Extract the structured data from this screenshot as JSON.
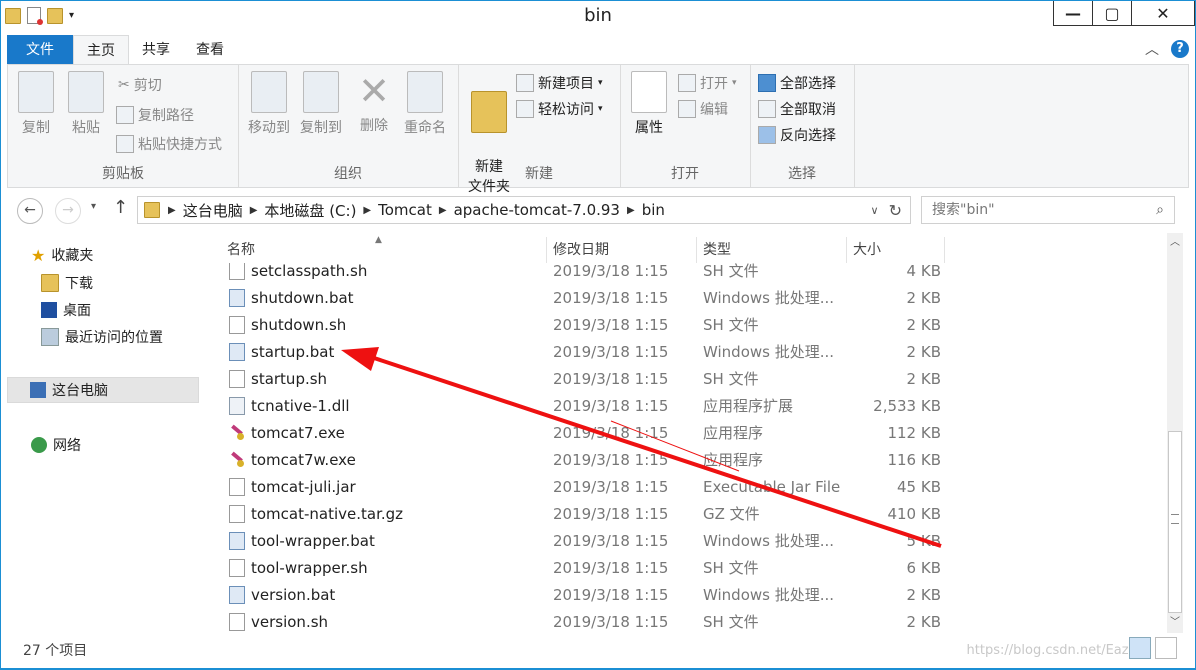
{
  "window": {
    "title": "bin"
  },
  "window_buttons": {
    "minimize": "—",
    "maximize": "▢",
    "close": "✕"
  },
  "tabs": [
    {
      "label": "文件"
    },
    {
      "label": "主页"
    },
    {
      "label": "共享"
    },
    {
      "label": "查看"
    }
  ],
  "ribbon": {
    "clipboard": {
      "label": "剪贴板",
      "copy": "复制",
      "paste": "粘贴",
      "cut": "剪切",
      "copy_path": "复制路径",
      "paste_shortcut": "粘贴快捷方式"
    },
    "organize": {
      "label": "组织",
      "move_to": "移动到",
      "copy_to": "复制到",
      "delete": "删除",
      "rename": "重命名"
    },
    "new": {
      "label": "新建",
      "new_folder": "新建\n文件夹",
      "new_item": "新建项目",
      "easy_access": "轻松访问"
    },
    "open": {
      "label": "打开",
      "properties": "属性",
      "open": "打开",
      "edit": "编辑"
    },
    "select": {
      "label": "选择",
      "select_all": "全部选择",
      "select_none": "全部取消",
      "invert": "反向选择"
    }
  },
  "address": {
    "crumbs": [
      "这台电脑",
      "本地磁盘 (C:)",
      "Tomcat",
      "apache-tomcat-7.0.93",
      "bin"
    ],
    "search_placeholder": "搜索\"bin\""
  },
  "nav": {
    "favorites": "收藏夹",
    "downloads": "下载",
    "desktop": "桌面",
    "recent": "最近访问的位置",
    "this_pc": "这台电脑",
    "network": "网络"
  },
  "columns": {
    "name": "名称",
    "date": "修改日期",
    "type": "类型",
    "size": "大小"
  },
  "files": [
    {
      "name": "setclasspath.sh",
      "date": "2019/3/18 1:15",
      "type": "SH 文件",
      "size": "4 KB",
      "icon": "file"
    },
    {
      "name": "shutdown.bat",
      "date": "2019/3/18 1:15",
      "type": "Windows 批处理...",
      "size": "2 KB",
      "icon": "bat"
    },
    {
      "name": "shutdown.sh",
      "date": "2019/3/18 1:15",
      "type": "SH 文件",
      "size": "2 KB",
      "icon": "file"
    },
    {
      "name": "startup.bat",
      "date": "2019/3/18 1:15",
      "type": "Windows 批处理...",
      "size": "2 KB",
      "icon": "bat"
    },
    {
      "name": "startup.sh",
      "date": "2019/3/18 1:15",
      "type": "SH 文件",
      "size": "2 KB",
      "icon": "file"
    },
    {
      "name": "tcnative-1.dll",
      "date": "2019/3/18 1:15",
      "type": "应用程序扩展",
      "size": "2,533 KB",
      "icon": "dll"
    },
    {
      "name": "tomcat7.exe",
      "date": "2019/3/18 1:15",
      "type": "应用程序",
      "size": "112 KB",
      "icon": "exe"
    },
    {
      "name": "tomcat7w.exe",
      "date": "2019/3/18 1:15",
      "type": "应用程序",
      "size": "116 KB",
      "icon": "exe"
    },
    {
      "name": "tomcat-juli.jar",
      "date": "2019/3/18 1:15",
      "type": "Executable Jar File",
      "size": "45 KB",
      "icon": "file"
    },
    {
      "name": "tomcat-native.tar.gz",
      "date": "2019/3/18 1:15",
      "type": "GZ 文件",
      "size": "410 KB",
      "icon": "file"
    },
    {
      "name": "tool-wrapper.bat",
      "date": "2019/3/18 1:15",
      "type": "Windows 批处理...",
      "size": "5 KB",
      "icon": "bat"
    },
    {
      "name": "tool-wrapper.sh",
      "date": "2019/3/18 1:15",
      "type": "SH 文件",
      "size": "6 KB",
      "icon": "file"
    },
    {
      "name": "version.bat",
      "date": "2019/3/18 1:15",
      "type": "Windows 批处理...",
      "size": "2 KB",
      "icon": "bat"
    },
    {
      "name": "version.sh",
      "date": "2019/3/18 1:15",
      "type": "SH 文件",
      "size": "2 KB",
      "icon": "file"
    }
  ],
  "status": {
    "count": "27 个项目",
    "watermark": "https://blog.csdn.net/Eaze..."
  },
  "colors": {
    "accent": "#1979ca",
    "arrow": "#ee1111"
  }
}
